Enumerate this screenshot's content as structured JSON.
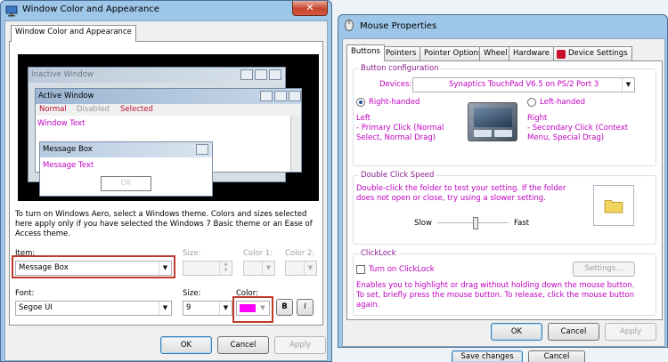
{
  "colors": {
    "titlebar": "#9ec6e8",
    "accent_magenta": "#c000c0",
    "selected_color": "#ff00ff",
    "highlight_box": "#c0392b"
  },
  "wca": {
    "title": "Window Color and Appearance",
    "tab": "Window Color and Appearance",
    "preview": {
      "inactive_title": "Inactive Window",
      "active_title": "Active Window",
      "menu_normal": "Normal",
      "menu_disabled": "Disabled",
      "menu_selected": "Selected",
      "window_text": "Window Text",
      "msgbox_title": "Message Box",
      "msgbox_text": "Message Text",
      "msgbox_ok": "OK"
    },
    "info_text": "To turn on Windows Aero, select a Windows theme.  Colors and sizes selected here apply only if you have selected the Windows 7 Basic theme or an Ease of Access theme.",
    "item_label": "Item:",
    "item_value": "Message Box",
    "size_label": "Size:",
    "color1_label": "Color 1:",
    "color2_label": "Color 2:",
    "font_label": "Font:",
    "font_value": "Segoe UI",
    "font_size_label": "Size:",
    "font_size_value": "9",
    "font_color_label": "Color:",
    "bold": "B",
    "italic": "I",
    "ok": "OK",
    "cancel": "Cancel",
    "apply": "Apply",
    "close_glyph": "✕"
  },
  "mouse": {
    "title": "Mouse Properties",
    "tabs": [
      "Buttons",
      "Pointers",
      "Pointer Options",
      "Wheel",
      "Hardware",
      "Device Settings"
    ],
    "button_config": "Button configuration",
    "devices_label": "Devices:",
    "devices_value": "Synaptics TouchPad V6.5 on PS/2 Port 3",
    "right_handed": "Right-handed",
    "left_handed": "Left-handed",
    "left_title": "Left",
    "left_desc": "- Primary Click (Normal Select, Normal Drag)",
    "right_title": "Right",
    "right_desc": "- Secondary Click (Context Menu, Special Drag)",
    "dcs_title": "Double Click Speed",
    "dcs_text": "Double-click the folder to test your setting.  If the folder does not open or close, try using a slower setting.",
    "slow": "Slow",
    "fast": "Fast",
    "clicklock_title": "ClickLock",
    "clicklock_checkbox": "Turn on ClickLock",
    "settings": "Settings...",
    "clicklock_text": "Enables you to highlight or drag without holding down the mouse button.  To set, briefly press the mouse button.  To release, click the mouse button again.",
    "ok": "OK",
    "cancel": "Cancel",
    "apply": "Apply"
  },
  "bottom": {
    "save_changes": "Save changes",
    "cancel": "Cancel"
  }
}
